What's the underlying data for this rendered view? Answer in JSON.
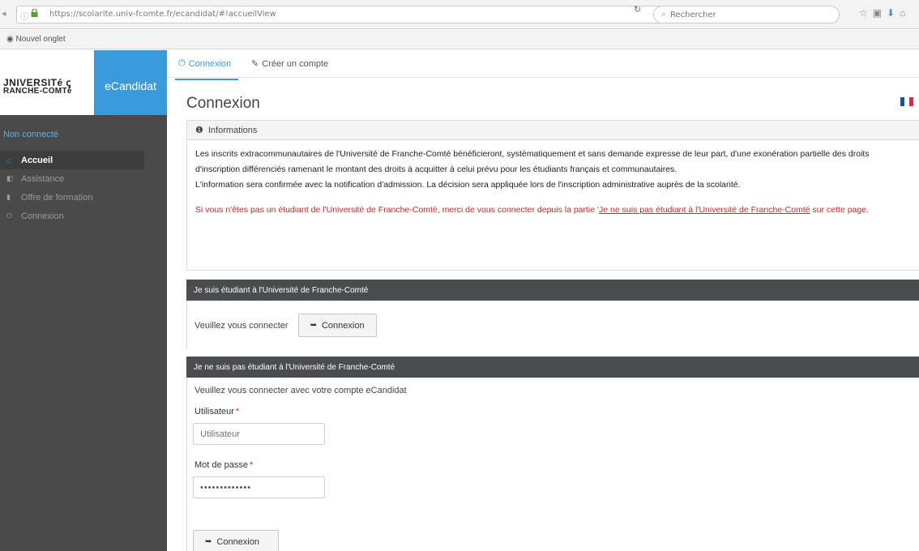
{
  "browser": {
    "url": "https://scolarite.univ-fcomte.fr/ecandidat/#!accueilView",
    "search_placeholder": "Rechercher",
    "bookmark": "Nouvel onglet"
  },
  "sidebar": {
    "logo_line1": "JNIVERSITé ꞔ",
    "logo_line2": "RANCHE-COMTé",
    "brand": "eCandidat",
    "status": "Non connecté",
    "items": [
      {
        "label": "Accueil",
        "icon": "home-icon"
      },
      {
        "label": "Assistance",
        "icon": "assistance-icon"
      },
      {
        "label": "Offre de formation",
        "icon": "bookmark-icon"
      },
      {
        "label": "Connexion",
        "icon": "power-icon"
      }
    ]
  },
  "tabs": [
    {
      "label": "Connexion",
      "icon": "power-icon"
    },
    {
      "label": "Créer un compte",
      "icon": "wand-icon"
    }
  ],
  "page_title": "Connexion",
  "info": {
    "header": "Informations",
    "p1": "Les inscrits extracommunautaires de l'Université de Franche-Comté bénéficieront, systématiquement et sans demande expresse de leur part, d'une exonération partielle des droits d'inscription différenciés ramenant le montant des droits à acquitter à celui prévu pour les étudiants français et communautaires.",
    "p2": "L'information sera confirmée avec la notification d'admission. La décision sera appliquée lors de l'inscription administrative auprès de la scolarité.",
    "red_prefix": "Si vous n'êtes pas un étudiant de l'Université de Franche-Comté, merci de vous connecter depuis la partie '",
    "red_link": "Je ne suis pas étudiant à l'Université de Franche-Comté",
    "red_suffix": " sur cette page."
  },
  "student_panel": {
    "header": "Je suis étudiant à l'Université de Franche-Comté",
    "prompt": "Veuillez vous connecter",
    "button": "Connexion"
  },
  "non_student_panel": {
    "header": "Je ne suis pas étudiant à l'Université de Franche-Comté",
    "lead": "Veuillez vous connecter avec votre compte eCandidat",
    "user_label": "Utilisateur",
    "user_placeholder": "Utilisateur",
    "pass_label": "Mot de passe",
    "pass_value": "•••••••••••••",
    "required_mark": "*",
    "button": "Connexion"
  },
  "colors": {
    "accent": "#3b9ad9",
    "sidebar": "#4a4a4a",
    "panel_header": "#4a4c50",
    "error": "#d9232a"
  }
}
